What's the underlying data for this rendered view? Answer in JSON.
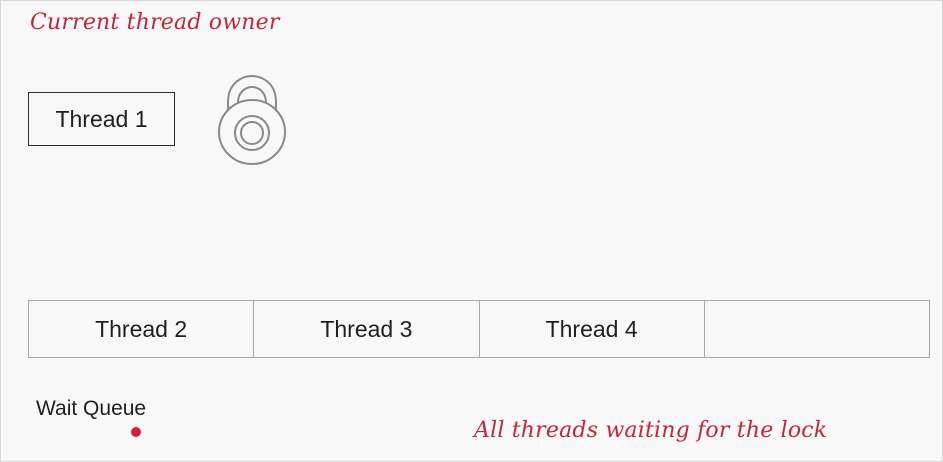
{
  "captions": {
    "current_owner": "Current thread owner",
    "waiting": "All threads waiting for the lock"
  },
  "owner": {
    "label": "Thread 1"
  },
  "wait_queue": {
    "label": "Wait Queue",
    "slots": [
      "Thread 2",
      "Thread 3",
      "Thread 4",
      ""
    ]
  },
  "colors": {
    "annotation": "#c4263a",
    "box_border": "#2b2b2b",
    "queue_border": "#a8a8a8",
    "lock_stroke": "#8a8a8a",
    "marker": "#d3203a"
  },
  "icons": {
    "lock": "padlock-icon"
  }
}
